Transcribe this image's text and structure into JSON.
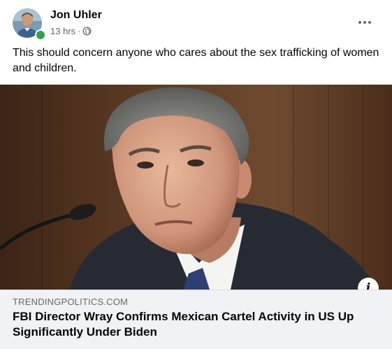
{
  "post": {
    "author": "Jon Uhler",
    "time": "13 hrs",
    "separator": "·",
    "privacy_icon": "globe-icon",
    "more_icon": "more-horizontal-icon",
    "text": "This should concern anyone who cares about the sex trafficking of women and children."
  },
  "link": {
    "domain": "TRENDINGPOLITICS.COM",
    "headline": "FBI Director Wray Confirms Mexican Cartel Activity in US Up Significantly Under Biden",
    "info_icon": "info-icon",
    "info_glyph": "i"
  },
  "colors": {
    "online": "#31a24c",
    "secondary_text": "#65676b",
    "card_background": "#f0f2f5"
  }
}
